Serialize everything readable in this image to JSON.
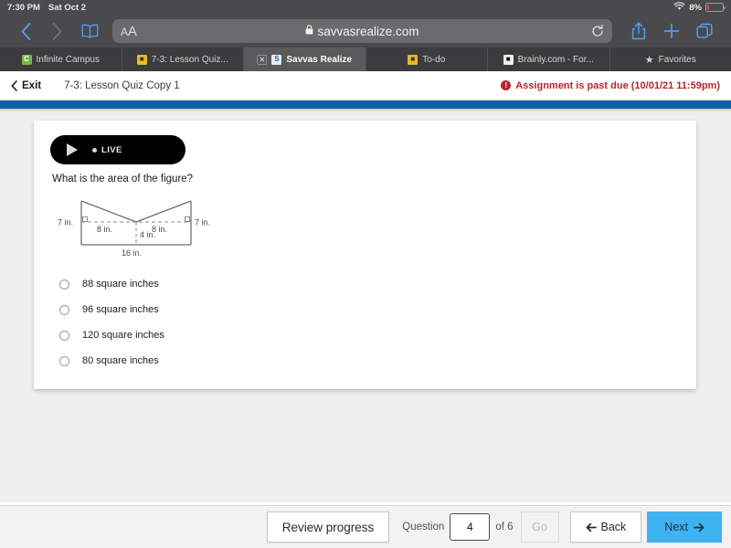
{
  "status_bar": {
    "time": "7:30 PM",
    "date": "Sat Oct 2",
    "battery_percent": "8%",
    "wifi_icon": "wifi-icon",
    "battery_icon": "battery-icon"
  },
  "browser": {
    "back_icon": "chevron-left-icon",
    "forward_icon": "chevron-right-icon",
    "bookmarks_icon": "book-icon",
    "text_size_label_small": "A",
    "text_size_label_large": "A",
    "lock_icon": "lock-icon",
    "url": "savvasrealize.com",
    "reload_icon": "reload-icon",
    "share_icon": "share-icon",
    "new_tab_icon": "plus-icon",
    "tabs_icon": "tabs-icon"
  },
  "favorites": [
    {
      "label": "Infinite Campus",
      "icon": "infinite-campus-icon",
      "glyph": "C",
      "icon_style": "ico-green",
      "active": false,
      "closable": false
    },
    {
      "label": "7-3: Lesson Quiz...",
      "icon": "lesson-quiz-icon",
      "glyph": "■",
      "icon_style": "ico-yellow",
      "active": false,
      "closable": false
    },
    {
      "label": "Savvas Realize",
      "icon": "savvas-realize-icon",
      "glyph": "S",
      "icon_style": "ico-blue",
      "active": true,
      "closable": true,
      "close_label": "✕"
    },
    {
      "label": "To-do",
      "icon": "todo-icon",
      "glyph": "■",
      "icon_style": "ico-yellow",
      "active": false,
      "closable": false
    },
    {
      "label": "Brainly.com - For...",
      "icon": "brainly-icon",
      "glyph": "■",
      "icon_style": "ico-dark",
      "active": false,
      "closable": false
    },
    {
      "label": "Favorites",
      "icon": "star-icon",
      "glyph": "★",
      "icon_style": "star",
      "active": false,
      "closable": false
    }
  ],
  "app_header": {
    "exit_label": "Exit",
    "exit_icon": "chevron-left-icon",
    "quiz_title": "7-3: Lesson Quiz Copy 1",
    "warning_icon": "alert-icon",
    "warning_glyph": "!",
    "warning_text": "Assignment is past due (10/01/21 11:59pm)"
  },
  "question": {
    "live_label": "LIVE",
    "play_icon": "play-icon",
    "live_dot_icon": "live-dot-icon",
    "prompt": "What is the area of the figure?",
    "figure": {
      "name": "area-figure-diagram",
      "label_left_height": "7 in.",
      "label_right_height": "7 in.",
      "label_top_left": "8 in.",
      "label_top_right": "8 in.",
      "label_notch_depth": "4 in.",
      "label_base": "16 in."
    },
    "choices": [
      {
        "label": "88 square inches",
        "selected": false
      },
      {
        "label": "96 square inches",
        "selected": false
      },
      {
        "label": "120 square inches",
        "selected": false
      },
      {
        "label": "80 square inches",
        "selected": false
      }
    ]
  },
  "bottom_bar": {
    "review_label": "Review progress",
    "question_word": "Question",
    "question_number": "4",
    "of_label": "of 6",
    "go_label": "Go",
    "back_label": "Back",
    "back_icon": "arrow-left-icon",
    "next_label": "Next",
    "next_icon": "arrow-right-icon"
  },
  "colors": {
    "accent_blue": "#3fb3f0",
    "band_blue": "#1360a4",
    "warning_red": "#b8242c",
    "battery_red": "#e0504a"
  }
}
